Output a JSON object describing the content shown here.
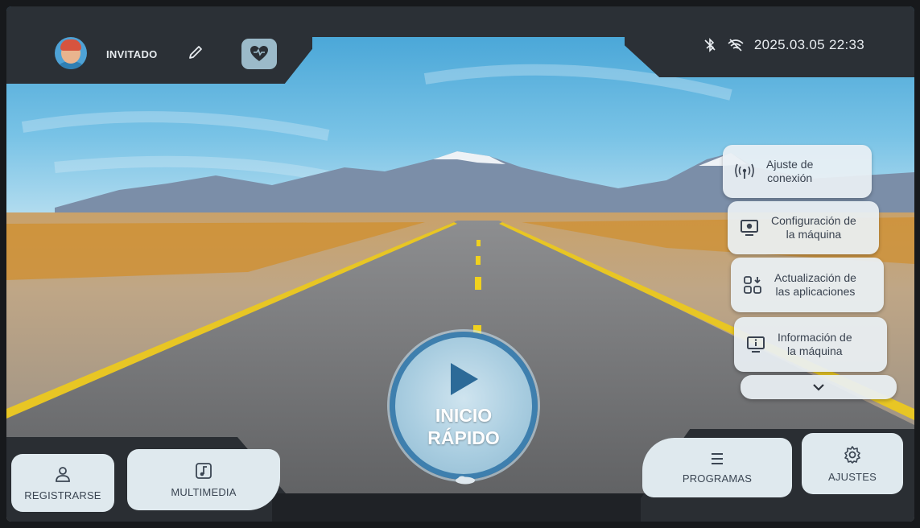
{
  "user": {
    "name": "INVITADO"
  },
  "status": {
    "clock": "2025.03.05 22:33"
  },
  "settings_menu": {
    "items": [
      {
        "label": "Ajuste de conexión",
        "line1": "Ajuste de",
        "line2": "conexión",
        "icon": "antenna-icon"
      },
      {
        "label": "Configuración de la máquina",
        "line1": "Configuración de",
        "line2": "la máquina",
        "icon": "monitor-gear-icon"
      },
      {
        "label": "Actualización de las aplicaciones",
        "line1": "Actualización de",
        "line2": "las aplicaciones",
        "icon": "apps-download-icon"
      },
      {
        "label": "Información de la máquina",
        "line1": "Información de",
        "line2": "la máquina",
        "icon": "monitor-info-icon"
      }
    ],
    "more_icon": "chevron-down-icon"
  },
  "quick_start": {
    "line1": "INICIO",
    "line2": "RÁPIDO"
  },
  "bottom": {
    "register_label": "REGISTRARSE",
    "multimedia_label": "MULTIMEDIA",
    "programs_label": "PROGRAMAS",
    "settings_label": "AJUSTES"
  },
  "colors": {
    "panel": "#2b3036",
    "card": "#e9f0f4",
    "accent_ring": "#3e7fae",
    "heart_button": "#9bbac9"
  }
}
